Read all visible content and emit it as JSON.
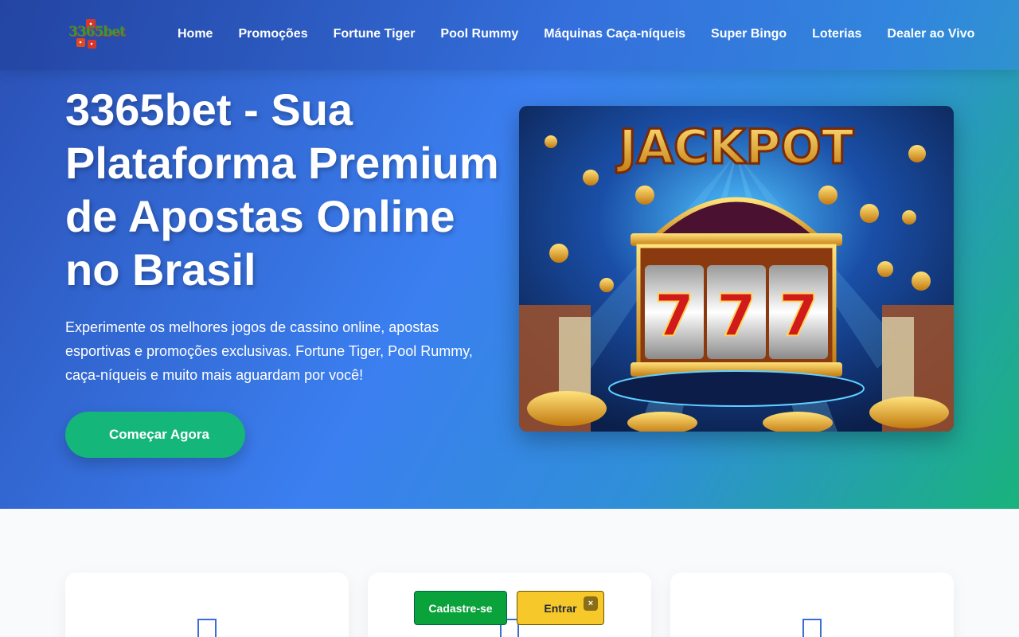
{
  "brand": {
    "logo_text": "3365bet"
  },
  "nav": {
    "items": [
      "Home",
      "Promoções",
      "Fortune Tiger",
      "Pool Rummy",
      "Máquinas Caça-níqueis",
      "Super Bingo",
      "Loterias",
      "Dealer ao Vivo"
    ]
  },
  "hero": {
    "title": "3365bet - Sua Plataforma Premium de Apostas Online no Brasil",
    "description": "Experimente os melhores jogos de cassino online, apostas esportivas e promoções exclusivas. Fortune Tiger, Pool Rummy, caça-níqueis e muito mais aguardam por você!",
    "cta_label": "Começar Agora",
    "cta_icon": "",
    "image": {
      "headline": "JACKPOT",
      "reels": [
        "7",
        "7",
        "7"
      ]
    }
  },
  "floating": {
    "signup_label": "Cadastre-se",
    "login_label": "Entrar",
    "close_label": "×"
  },
  "colors": {
    "cta": "#14b67a",
    "signup": "#0aa23a",
    "login": "#f7c82a"
  }
}
